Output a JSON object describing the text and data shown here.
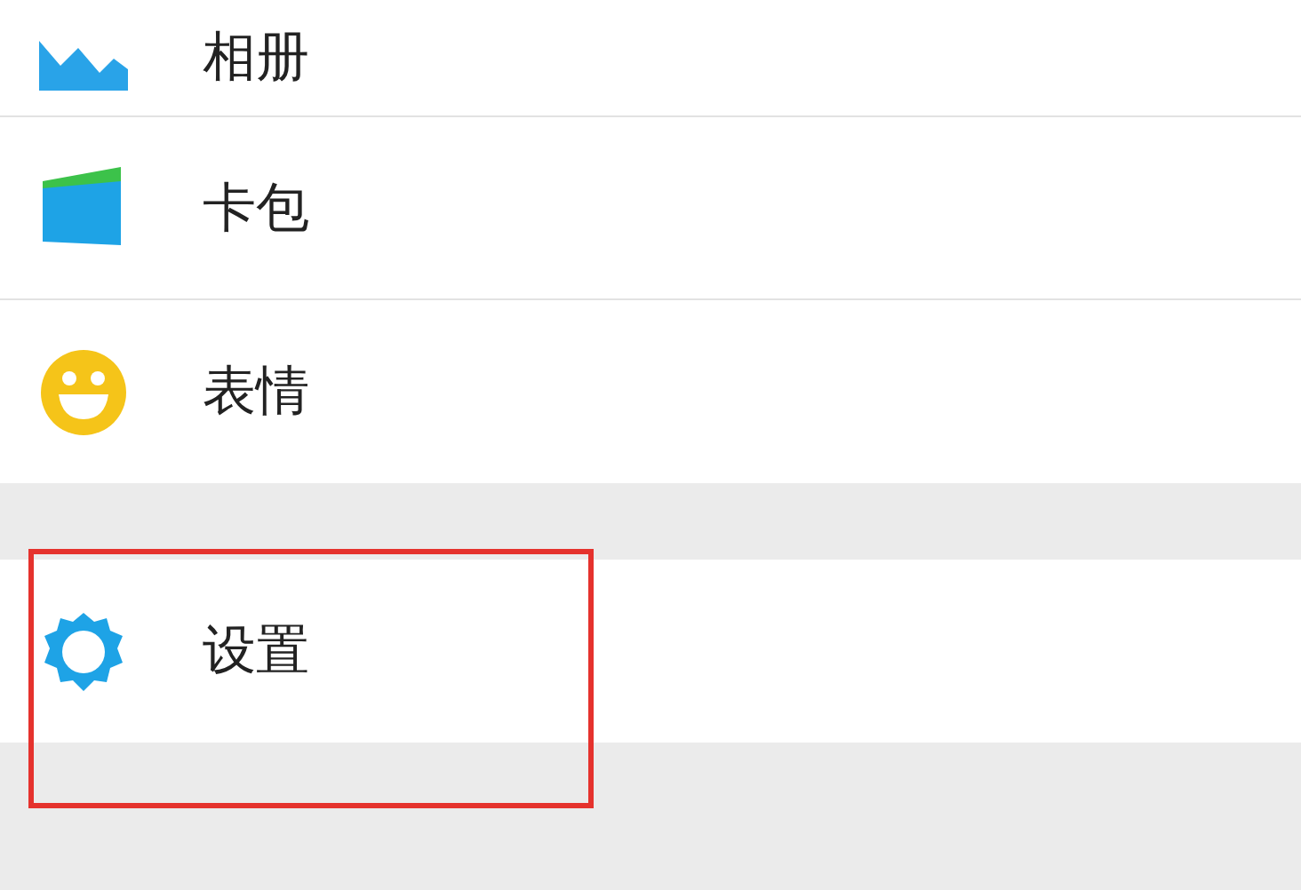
{
  "menu_groups": [
    {
      "items": [
        {
          "label": "相册",
          "kind": "album",
          "highlighted": false
        },
        {
          "label": "卡包",
          "kind": "wallet",
          "highlighted": false
        },
        {
          "label": "表情",
          "kind": "emoji",
          "highlighted": false
        }
      ]
    },
    {
      "items": [
        {
          "label": "设置",
          "kind": "settings",
          "highlighted": true
        }
      ]
    }
  ]
}
